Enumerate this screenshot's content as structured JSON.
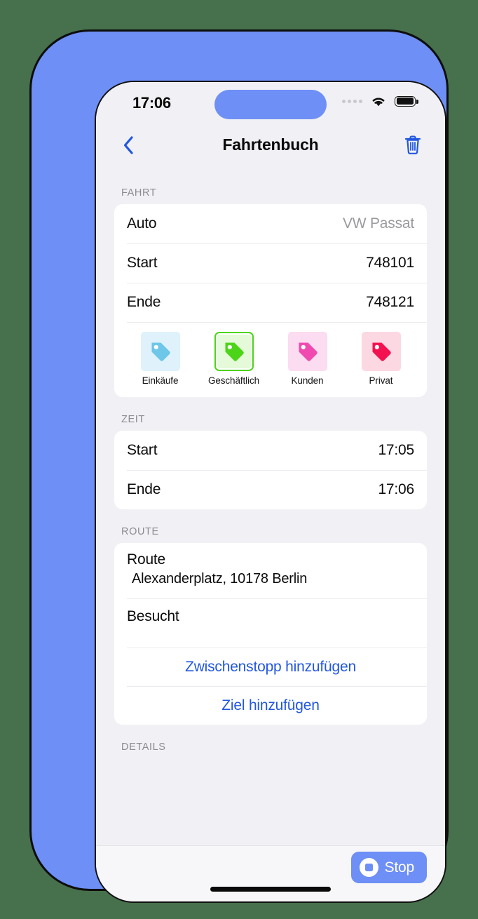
{
  "status_bar": {
    "time": "17:06",
    "cellular_icon": "cellular-dots-icon",
    "wifi_icon": "wifi-icon",
    "battery_icon": "battery-full-icon"
  },
  "nav": {
    "back_icon": "chevron-left-icon",
    "title": "Fahrtenbuch",
    "delete_icon": "trash-icon"
  },
  "sections": {
    "fahrt": {
      "header": "FAHRT",
      "rows": [
        {
          "label": "Auto",
          "value": "VW Passat",
          "muted": true
        },
        {
          "label": "Start",
          "value": "748101",
          "muted": false
        },
        {
          "label": "Ende",
          "value": "748121",
          "muted": false
        }
      ],
      "tags": [
        {
          "label": "Einkäufe",
          "color": "#6ec6e8",
          "bg": "#dff1fa",
          "selected": false
        },
        {
          "label": "Geschäftlich",
          "color": "#4cd418",
          "bg": "#e4fad8",
          "selected": true
        },
        {
          "label": "Kunden",
          "color": "#f04ab0",
          "bg": "#fbdcf0",
          "selected": false
        },
        {
          "label": "Privat",
          "color": "#f4114f",
          "bg": "#fcd8e2",
          "selected": false
        }
      ]
    },
    "zeit": {
      "header": "ZEIT",
      "rows": [
        {
          "label": "Start",
          "value": "17:05"
        },
        {
          "label": "Ende",
          "value": "17:06"
        }
      ]
    },
    "route": {
      "header": "ROUTE",
      "route_title": "Route",
      "route_value": "Alexanderplatz, 10178 Berlin",
      "visited_label": "Besucht",
      "add_stop_label": "Zwischenstopp hinzufügen",
      "add_destination_label": "Ziel hinzufügen"
    },
    "details": {
      "header": "DETAILS"
    }
  },
  "toolbar": {
    "stop_label": "Stop",
    "stop_icon": "stop-circle-icon"
  },
  "colors": {
    "accent_blue": "#6e8ff5",
    "link_blue": "#2257e0",
    "screen_bg": "#f1f1f5",
    "card_bg": "#ffffff",
    "page_bg": "#47704c"
  }
}
